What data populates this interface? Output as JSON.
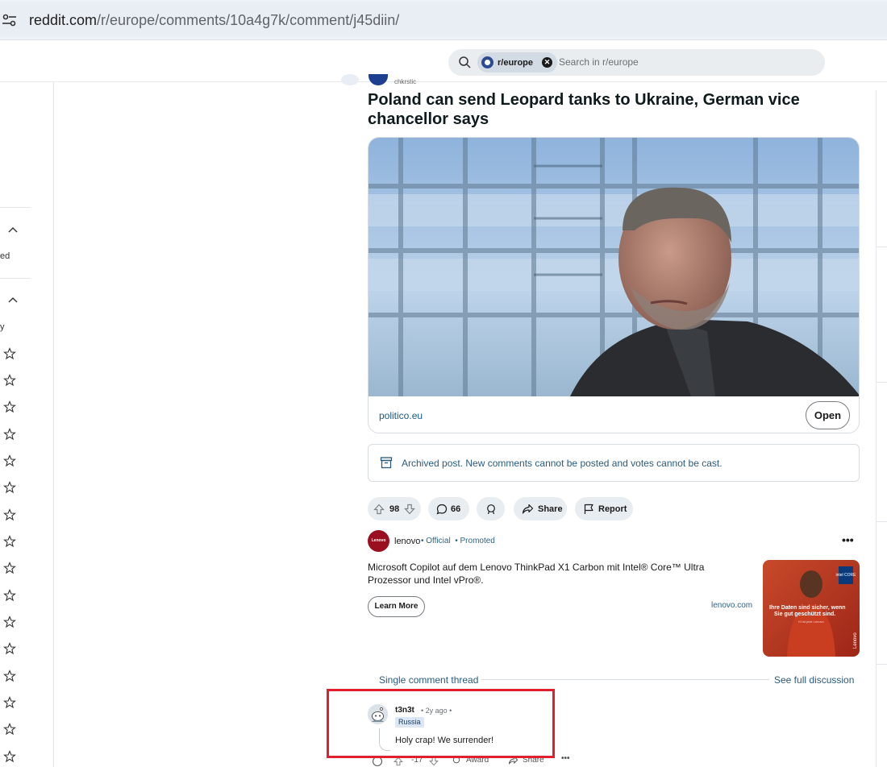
{
  "browser": {
    "url_host": "reddit.com",
    "url_path": "/r/europe/comments/10a4g7k/comment/j45diin/"
  },
  "search": {
    "chip_label": "r/europe",
    "placeholder": "Search in r/europe"
  },
  "left_rail": {
    "partial_text_1": "ed",
    "partial_text_2": "y"
  },
  "post": {
    "author_partial": "chkrstic",
    "title": "Poland can send Leopard tanks to Ukraine, German vice chancellor says",
    "link_domain": "politico.eu",
    "open_label": "Open",
    "archived_notice": "Archived post. New comments cannot be posted and votes cannot be cast.",
    "votes": "98",
    "comments": "66",
    "share_label": "Share",
    "report_label": "Report"
  },
  "ad": {
    "avatar_text": "Lenovo",
    "name": "lenovo",
    "official": "• Official",
    "promoted": "• Promoted",
    "more": "•••",
    "text": "Microsoft Copilot auf dem Lenovo ThinkPad X1 Carbon mit Intel® Core™ Ultra Prozessor und Intel vPro®.",
    "cta": "Learn More",
    "domain": "lenovo.com",
    "image_headline": "Ihre Daten sind sicher, wenn Sie gut geschützt sind.",
    "image_sub": "KI ist jetzt Lenovo",
    "image_brand": "Lenovo",
    "image_chip": "intel CORE"
  },
  "thread": {
    "single_label": "Single comment thread",
    "see_full": "See full discussion"
  },
  "comment": {
    "user": "t3n3t",
    "time": "• 2y ago •",
    "flair": "Russia",
    "text": "Holy crap! We surrender!",
    "votes": "-17",
    "award_label": "Award",
    "share_label": "Share",
    "more": "•••"
  },
  "colors": {
    "highlight": "#e0202c",
    "link": "#2a5b7c",
    "ad_brand": "#9a1020"
  }
}
